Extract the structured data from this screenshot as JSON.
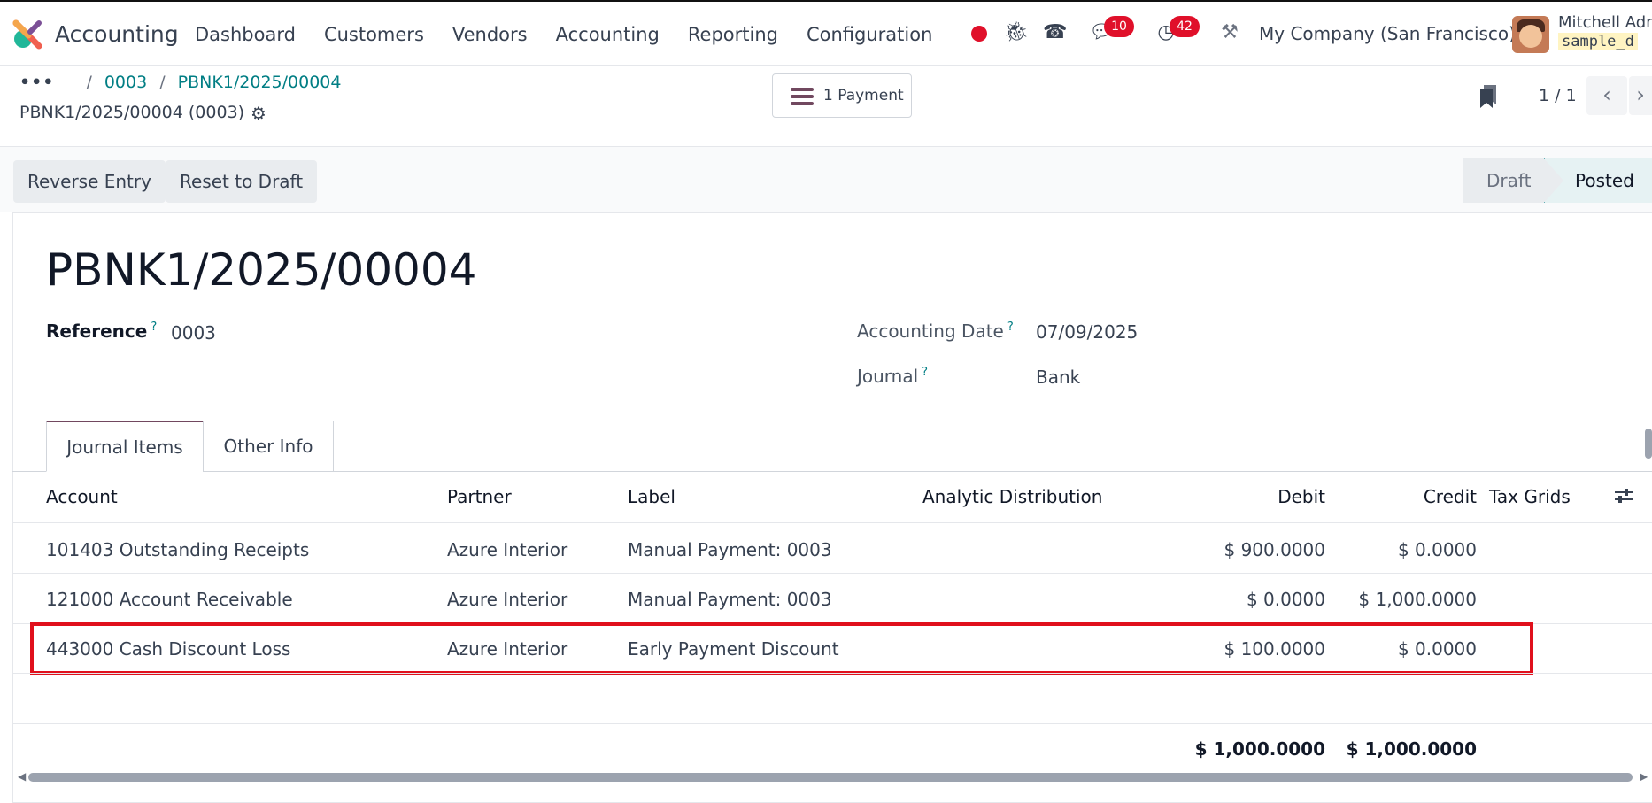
{
  "app": {
    "name": "Accounting"
  },
  "menu": [
    "Dashboard",
    "Customers",
    "Vendors",
    "Accounting",
    "Reporting",
    "Configuration"
  ],
  "systray": {
    "chat_badge": "10",
    "activity_badge": "42",
    "company": "My Company (San Francisco)",
    "user_name": "Mitchell Adm",
    "db_name": "sample_d"
  },
  "breadcrumb": {
    "ellipsis": "•••",
    "items": [
      "0003",
      "PBNK1/2025/00004"
    ],
    "separator": "/"
  },
  "record": {
    "title": "PBNK1/2025/00004 (0003)"
  },
  "smart_button": {
    "label": "1 Payment"
  },
  "pager": {
    "value": "1 / 1"
  },
  "actions": {
    "reverse": "Reverse Entry",
    "reset": "Reset to Draft"
  },
  "stages": {
    "draft": "Draft",
    "posted": "Posted"
  },
  "entry": {
    "name": "PBNK1/2025/00004",
    "reference_label": "Reference",
    "reference": "0003",
    "date_label": "Accounting Date",
    "date": "07/09/2025",
    "journal_label": "Journal",
    "journal": "Bank",
    "help_mark": "?"
  },
  "tabs": [
    "Journal Items",
    "Other Info"
  ],
  "table": {
    "headers": [
      "Account",
      "Partner",
      "Label",
      "Analytic Distribution",
      "Debit",
      "Credit",
      "Tax Grids"
    ],
    "rows": [
      {
        "account": "101403 Outstanding Receipts",
        "partner": "Azure Interior",
        "label": "Manual Payment: 0003",
        "debit": "$ 900.0000",
        "credit": "$ 0.0000"
      },
      {
        "account": "121000 Account Receivable",
        "partner": "Azure Interior",
        "label": "Manual Payment: 0003",
        "debit": "$ 0.0000",
        "credit": "$ 1,000.0000"
      },
      {
        "account": "443000 Cash Discount Loss",
        "partner": "Azure Interior",
        "label": "Early Payment Discount",
        "debit": "$ 100.0000",
        "credit": "$ 0.0000"
      }
    ],
    "totals": {
      "debit": "$ 1,000.0000",
      "credit": "$ 1,000.0000"
    }
  },
  "colors": {
    "accent": "#017e84",
    "brand": "#71485f",
    "highlight": "#e0101c",
    "badge": "#e0102a"
  }
}
